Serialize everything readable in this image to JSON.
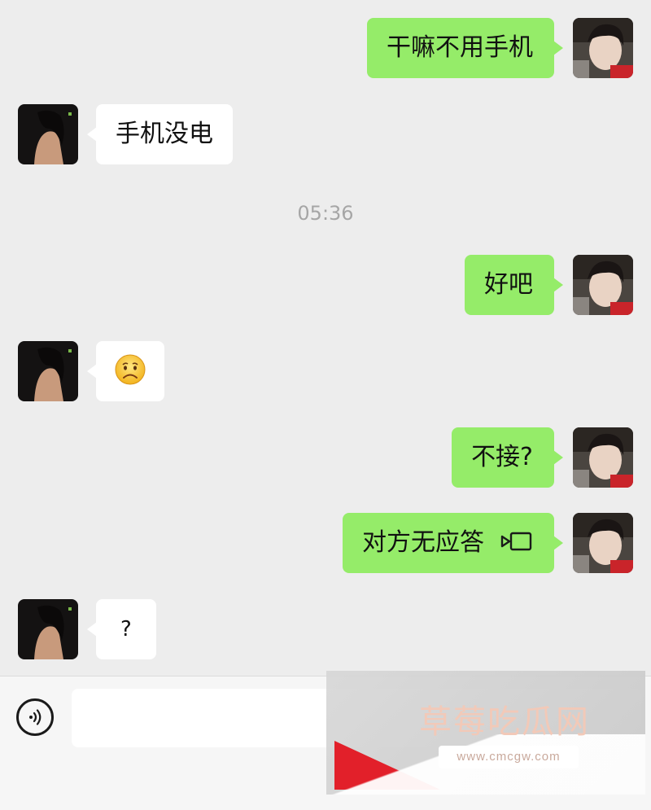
{
  "conversation": {
    "timestamp": "05:36",
    "messages": [
      {
        "sender": "me",
        "text": "干嘛不用手机"
      },
      {
        "sender": "them",
        "text": "手机没电"
      },
      {
        "sender": "me",
        "text": "好吧"
      },
      {
        "sender": "them",
        "emoji": "frowning-face"
      },
      {
        "sender": "me",
        "text": "不接?"
      },
      {
        "sender": "me",
        "text": "对方无应答",
        "icon": "video-call-icon"
      },
      {
        "sender": "them",
        "text": "?"
      }
    ]
  },
  "input_bar": {
    "placeholder": "",
    "value": ""
  },
  "watermark": {
    "title": "草莓吃瓜网",
    "url": "www.cmcgw.com"
  },
  "colors": {
    "background": "#ededed",
    "my_bubble": "#95ec69",
    "their_bubble": "#ffffff",
    "timestamp_text": "#a6a6a6"
  }
}
